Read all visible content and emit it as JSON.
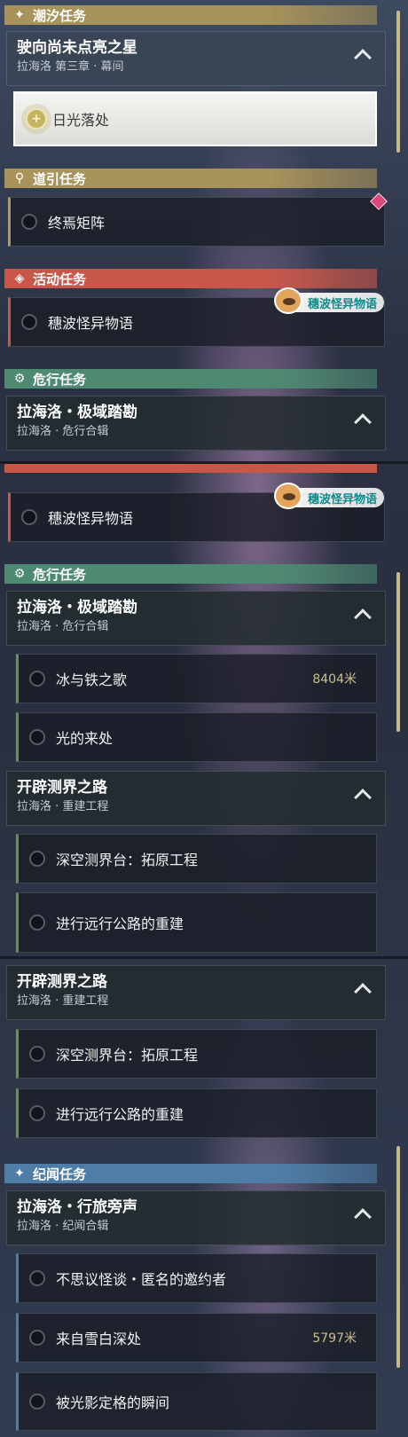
{
  "sections": {
    "tide": {
      "label": "潮汐任务",
      "color": "#a8935a"
    },
    "guide": {
      "label": "道引任务",
      "color": "#a8935a"
    },
    "event": {
      "label": "活动任务",
      "color": "#c8574a"
    },
    "danger": {
      "label": "危行任务",
      "color": "#4e8a72"
    },
    "lore": {
      "label": "纪闻任务",
      "color": "#4e7ea8"
    }
  },
  "quests": {
    "main_title": "驶向尚未点亮之星",
    "main_sub": "拉海洛 第三章 · 幕间",
    "main_active": "日光落处",
    "guide_item": "终焉矩阵",
    "event_item": "穗波怪异物语",
    "event_badge": "穗波怪异物语",
    "danger_group": "拉海洛・极域踏勘",
    "danger_sub": "拉海洛 · 危行合辑",
    "danger_item1": "冰与铁之歌",
    "danger_item1_dist": "8404米",
    "danger_item2": "光的来处",
    "rebuild_group": "开辟测界之路",
    "rebuild_sub": "拉海洛 · 重建工程",
    "rebuild_item1": "深空测界台：拓原工程",
    "rebuild_item2": "进行远行公路的重建",
    "lore_group": "拉海洛・行旅旁声",
    "lore_sub": "拉海洛 · 纪闻合辑",
    "lore_item1": "不思议怪谈・匿名的邀约者",
    "lore_item2": "来自雪白深处",
    "lore_item2_dist": "5797米",
    "lore_item3": "被光影定格的瞬间"
  },
  "icons": {
    "tide": "sparkle-icon",
    "guide": "map-pin-icon",
    "event": "event-icon",
    "danger": "danger-gear-icon",
    "lore": "sparkle-icon",
    "collapse": "chevron-up-icon",
    "track": "target-icon",
    "warning": "warning-diamond-icon"
  }
}
